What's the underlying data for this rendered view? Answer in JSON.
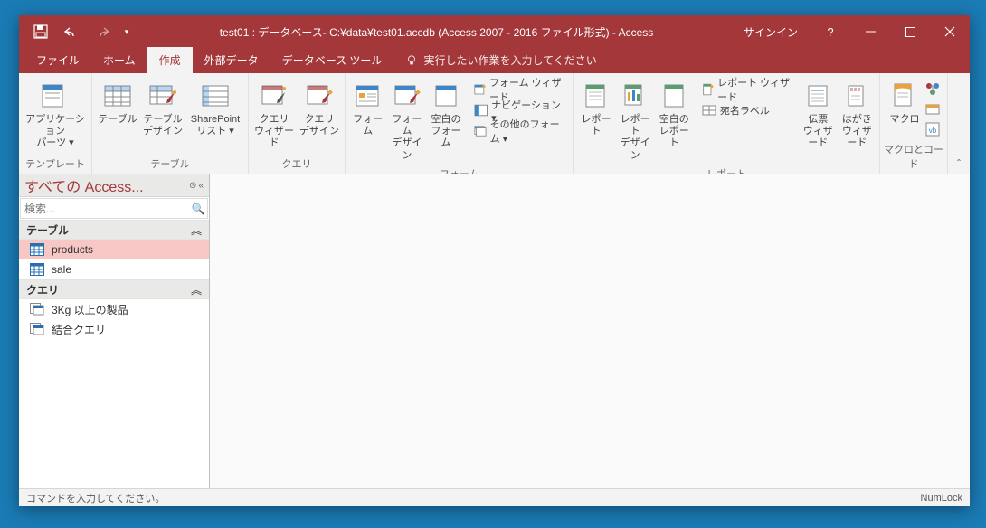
{
  "titlebar": {
    "title": "test01 : データベース- C:¥data¥test01.accdb (Access 2007 - 2016 ファイル形式) - Access",
    "signin": "サインイン"
  },
  "tabs": {
    "file": "ファイル",
    "home": "ホーム",
    "create": "作成",
    "external": "外部データ",
    "dbtools": "データベース ツール",
    "tellme": "実行したい作業を入力してください"
  },
  "ribbon": {
    "templates": {
      "label": "テンプレート",
      "app_parts": "アプリケーション\nパーツ ▾"
    },
    "tables": {
      "label": "テーブル",
      "table": "テーブル",
      "table_design": "テーブル\nデザイン",
      "sharepoint": "SharePoint\nリスト ▾"
    },
    "queries": {
      "label": "クエリ",
      "wizard": "クエリ\nウィザード",
      "design": "クエリ\nデザイン"
    },
    "forms": {
      "label": "フォーム",
      "form": "フォーム",
      "form_design": "フォーム\nデザイン",
      "blank": "空白の\nフォーム",
      "wizard": "フォーム ウィザード",
      "nav": "ナビゲーション ▾",
      "other": "その他のフォーム ▾"
    },
    "reports": {
      "label": "レポート",
      "report": "レポート",
      "report_design": "レポート\nデザイン",
      "blank": "空白の\nレポート",
      "wizard": "レポート ウィザード",
      "labels": "宛名ラベル",
      "denpyo": "伝票\nウィザード",
      "hagaki": "はがき\nウィザード"
    },
    "macros": {
      "label": "マクロとコード",
      "macro": "マクロ"
    }
  },
  "nav": {
    "header": "すべての Access...",
    "search_placeholder": "検索...",
    "cat_tables": "テーブル",
    "cat_queries": "クエリ",
    "items": {
      "products": "products",
      "sale": "sale",
      "q1": "3Kg 以上の製品",
      "q2": "結合クエリ"
    }
  },
  "status": {
    "left": "コマンドを入力してください。",
    "right": "NumLock"
  }
}
